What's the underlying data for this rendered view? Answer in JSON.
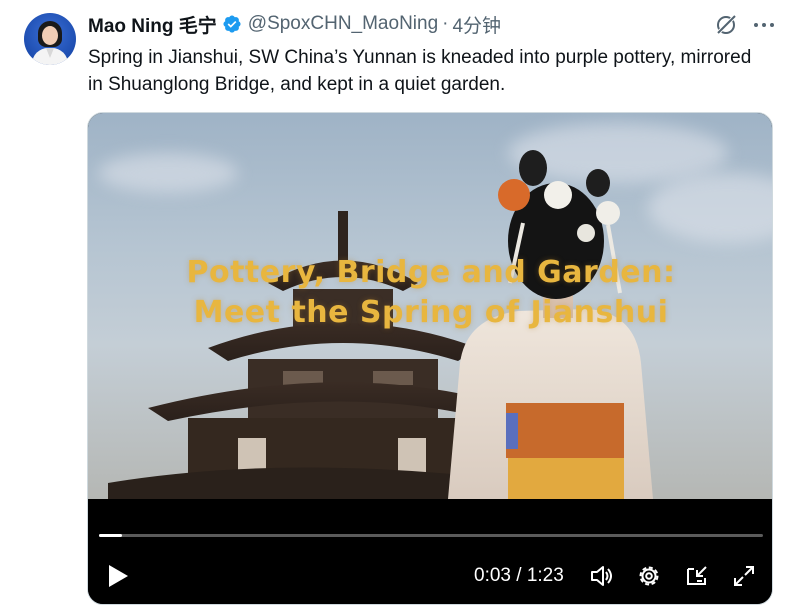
{
  "tweet": {
    "author_name": "Mao Ning 毛宁",
    "handle": "@SpoxCHN_MaoNing",
    "separator": "·",
    "time": "4分钟",
    "text": "Spring in Jianshui, SW China’s Yunnan is kneaded into purple pottery, mirrored in Shuanglong Bridge, and kept in a quiet garden."
  },
  "video": {
    "overlay_line1": "Pottery, Bridge and Garden:",
    "overlay_line2": "Meet the Spring of Jianshui",
    "time_display": "0:03 / 1:23",
    "progress": 0.035
  },
  "icons": {
    "verified": "verified-badge-icon",
    "grok": "grok-icon",
    "more": "more-icon",
    "play": "play-icon",
    "volume": "volume-icon",
    "settings": "settings-icon",
    "pip": "picture-in-picture-icon",
    "fullscreen": "fullscreen-icon"
  },
  "colors": {
    "text_primary": "#0f1419",
    "text_secondary": "#536471",
    "verified_blue": "#1d9bf0",
    "overlay_gold": "#e8b63f"
  }
}
